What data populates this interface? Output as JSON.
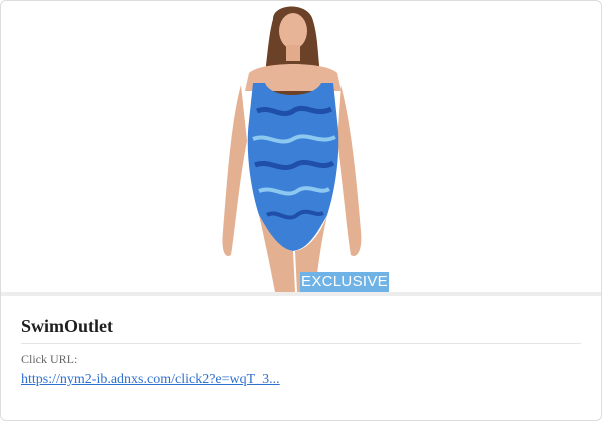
{
  "ad": {
    "brand": "SwimOutlet",
    "badge": "EXCLUSIVE",
    "click_label": "Click URL:",
    "click_url": "https://nym2-ib.adnxs.com/click2?e=wqT_3..."
  },
  "colors": {
    "badge_bg": "#6fb2e6",
    "link": "#2f6fce",
    "swimsuit_primary": "#3b7fd6",
    "swimsuit_dark": "#1f4fa8"
  }
}
